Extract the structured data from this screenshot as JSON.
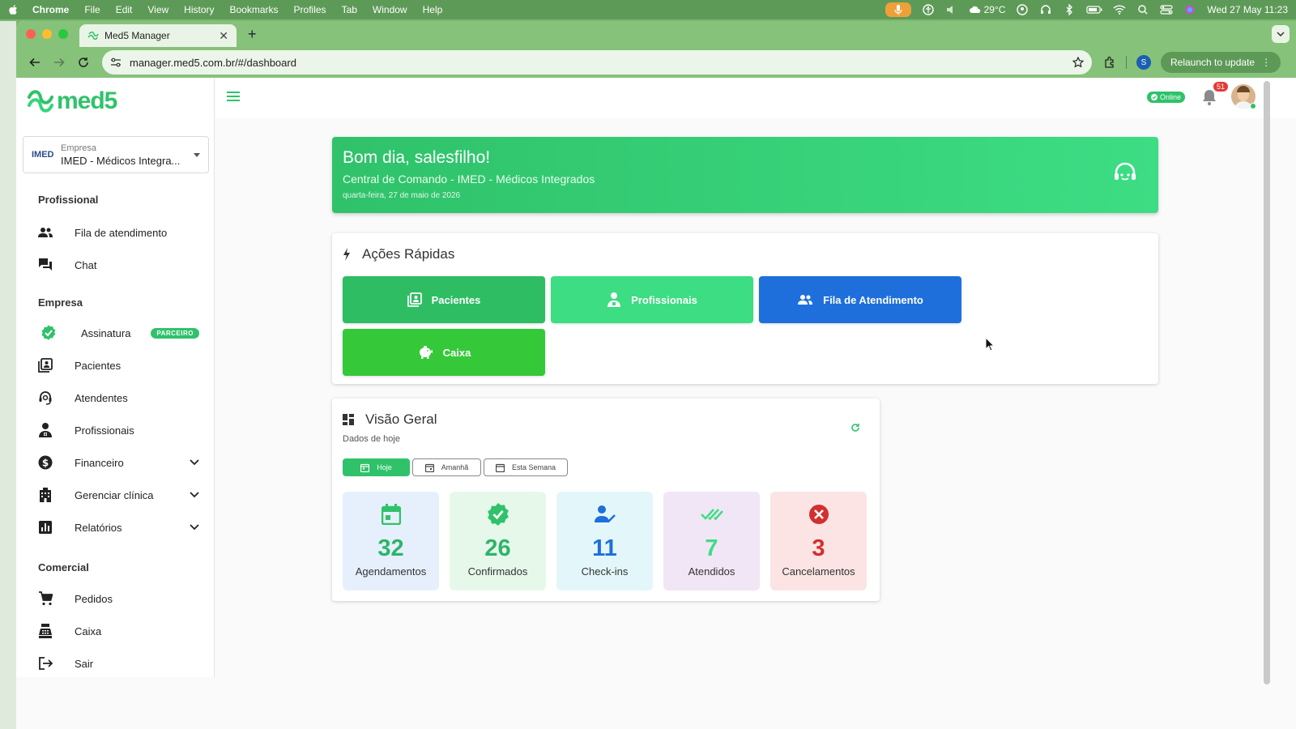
{
  "menubar": {
    "items": [
      "Chrome",
      "File",
      "Edit",
      "View",
      "History",
      "Bookmarks",
      "Profiles",
      "Tab",
      "Window",
      "Help"
    ],
    "weather": "29°C",
    "datetime": "Wed 27 May  11:23"
  },
  "browser": {
    "tab_title": "Med5 Manager",
    "url": "manager.med5.com.br/#/dashboard",
    "profile_initial": "S",
    "relaunch_label": "Relaunch to update"
  },
  "sidebar": {
    "logo_text": "med5",
    "company": {
      "label": "Empresa",
      "logo": "IMED",
      "value": "IMED - Médicos Integra..."
    },
    "sections": {
      "profissional": "Profissional",
      "empresa": "Empresa",
      "comercial": "Comercial"
    },
    "items": {
      "fila": "Fila de atendimento",
      "chat": "Chat",
      "assinatura": "Assinatura",
      "assinatura_badge": "PARCEIRO",
      "pacientes": "Pacientes",
      "atendentes": "Atendentes",
      "profissionais": "Profissionais",
      "financeiro": "Financeiro",
      "gerenciar": "Gerenciar clínica",
      "relatorios": "Relatórios",
      "pedidos": "Pedidos",
      "caixa": "Caixa",
      "sair": "Sair"
    }
  },
  "topbar": {
    "online_label": "Online",
    "notification_count": "51"
  },
  "welcome": {
    "greeting": "Bom dia, salesfilho!",
    "subtitle": "Central de Comando - IMED - Médicos Integrados",
    "date": "quarta-feira, 27 de maio de 2026"
  },
  "quick_actions": {
    "title": "Ações Rápidas",
    "buttons": {
      "pacientes": "Pacientes",
      "profissionais": "Profissionais",
      "fila": "Fila de Atendimento",
      "caixa": "Caixa"
    }
  },
  "overview": {
    "title": "Visão Geral",
    "subtitle": "Dados de hoje",
    "filters": {
      "hoje": "Hoje",
      "amanha": "Amanhã",
      "semana": "Esta Semana"
    },
    "stats": {
      "agendamentos": {
        "value": "32",
        "label": "Agendamentos"
      },
      "confirmados": {
        "value": "26",
        "label": "Confirmados"
      },
      "checkins": {
        "value": "11",
        "label": "Check-ins"
      },
      "atendidos": {
        "value": "7",
        "label": "Atendidos"
      },
      "cancelamentos": {
        "value": "3",
        "label": "Cancelamentos"
      }
    }
  },
  "colors": {
    "brand_green": "#2fc26a",
    "quick_green_dark": "#2ebd63",
    "quick_green_light": "#3ddd84",
    "quick_blue": "#1e6fdc",
    "quick_caixa": "#35c93a",
    "cancel_red": "#d32f2f"
  }
}
